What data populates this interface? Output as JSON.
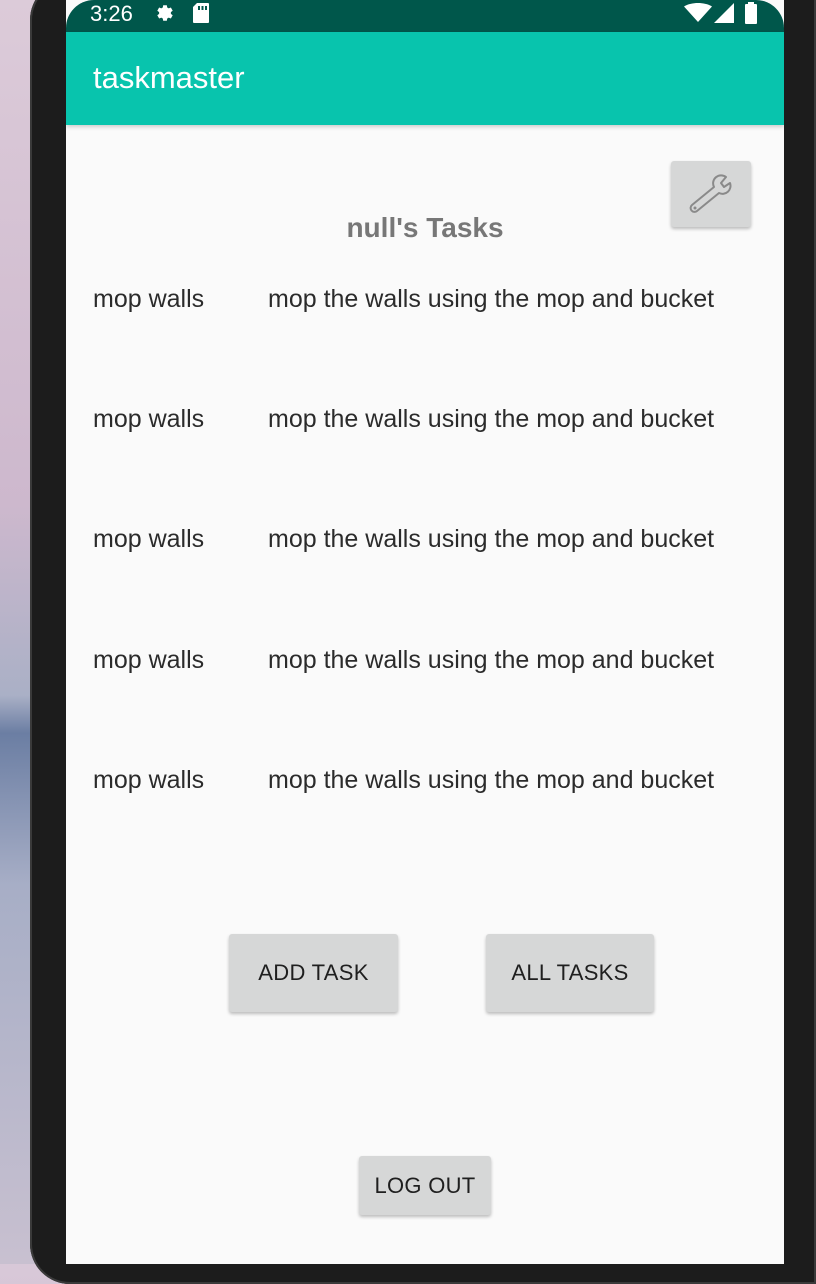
{
  "status_bar": {
    "time": "3:26",
    "icons": [
      "gear-icon",
      "sd-card-icon",
      "wifi-icon",
      "signal-icon",
      "battery-icon"
    ],
    "background": "#00574b"
  },
  "app_bar": {
    "title": "taskmaster",
    "background": "#08c4ad"
  },
  "settings_button": {
    "icon": "wrench-icon"
  },
  "page": {
    "title": "null's Tasks"
  },
  "tasks": [
    {
      "title": "mop walls",
      "body": "mop the walls using the mop and bucket"
    },
    {
      "title": "mop walls",
      "body": "mop the walls using the mop and bucket"
    },
    {
      "title": "mop walls",
      "body": "mop the walls using the mop and bucket"
    },
    {
      "title": "mop walls",
      "body": "mop the walls using the mop and bucket"
    },
    {
      "title": "mop walls",
      "body": "mop the walls using the mop and bucket"
    }
  ],
  "buttons": {
    "add_task": "ADD TASK",
    "all_tasks": "ALL TASKS",
    "log_out": "LOG OUT"
  }
}
